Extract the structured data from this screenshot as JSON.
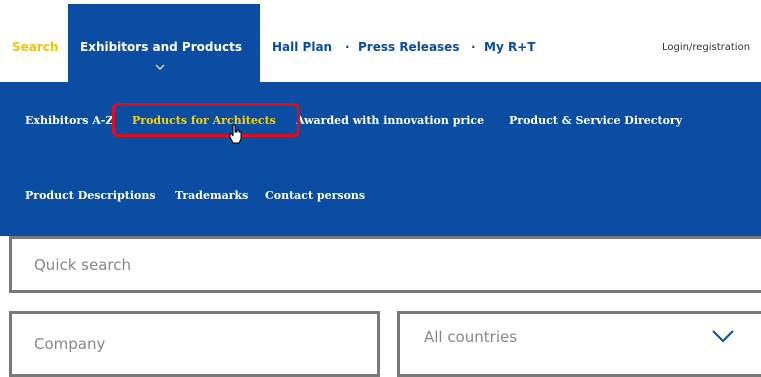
{
  "nav": {
    "search": "Search",
    "exhibitors_products": "Exhibitors and Products",
    "hall_plan": "Hall Plan",
    "separator": "·",
    "press_releases": "Press Releases",
    "my_rt": "My R+T",
    "login": "Login/registration"
  },
  "submenu": {
    "items": [
      "Exhibitors A-Z",
      "Products for Architects",
      "Awarded with innovation price",
      "Product & Service Directory",
      "Product Descriptions",
      "Trademarks",
      "Contact persons"
    ]
  },
  "search": {
    "quick_placeholder": "Quick search",
    "company_placeholder": "Company",
    "country_selected": "All countries"
  },
  "colors": {
    "brand_blue": "#0a4da2",
    "accent_yellow": "#f5c400",
    "highlight_red": "#e10d1d"
  },
  "icons": [
    "chevron-down-icon",
    "hand-cursor-icon"
  ]
}
